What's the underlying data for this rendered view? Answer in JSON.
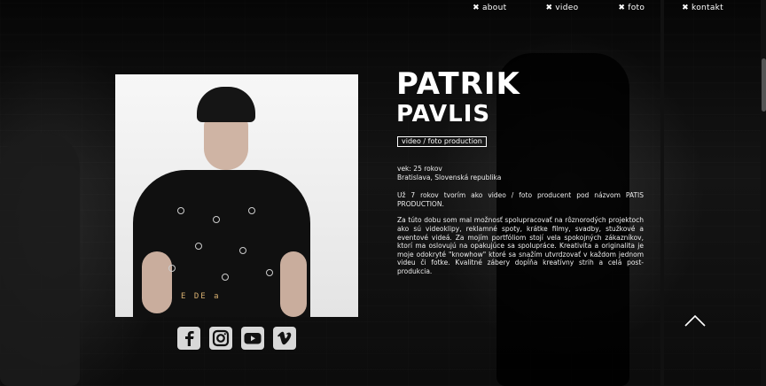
{
  "nav": {
    "items": [
      {
        "mark": "✖",
        "label": "about"
      },
      {
        "mark": "✖",
        "label": "video"
      },
      {
        "mark": "✖",
        "label": "foto"
      },
      {
        "mark": "✖",
        "label": "kontakt"
      }
    ]
  },
  "profile": {
    "first_name": "PATRIK",
    "last_name": "PAVLIS",
    "tagline": "video / foto production",
    "age": "vek: 25 rokov",
    "location": "Bratislava, Slovenská republika",
    "intro": "Už 7 rokov tvorím ako video / foto producent pod názvom PATIS PRODUCTION.",
    "bio": "Za túto dobu som mal možnosť spolupracovať na rôznorodých projektoch ako sú videoklipy, reklamné spoty, krátke filmy, svadby, stužkové a eventové videá. Za mojím portfóliom stojí vela spokojných zákazníkov, ktorí ma oslovujú na opakujúce sa spolupráce. Kreativita a originalita je moje odokryté \"knowhow\" ktoré sa snažím utvrdzovať v každom jednom videu či fotke. Kvalitné zábery dopĺňa kreatívny strih a celá post-produkcia.",
    "photo_print": "E DE a"
  },
  "socials": [
    {
      "name": "facebook-icon"
    },
    {
      "name": "instagram-icon"
    },
    {
      "name": "youtube-icon"
    },
    {
      "name": "vimeo-icon"
    }
  ],
  "colors": {
    "background": "#0a0a0a",
    "text": "#ffffff",
    "icon": "#d8d8d8"
  }
}
